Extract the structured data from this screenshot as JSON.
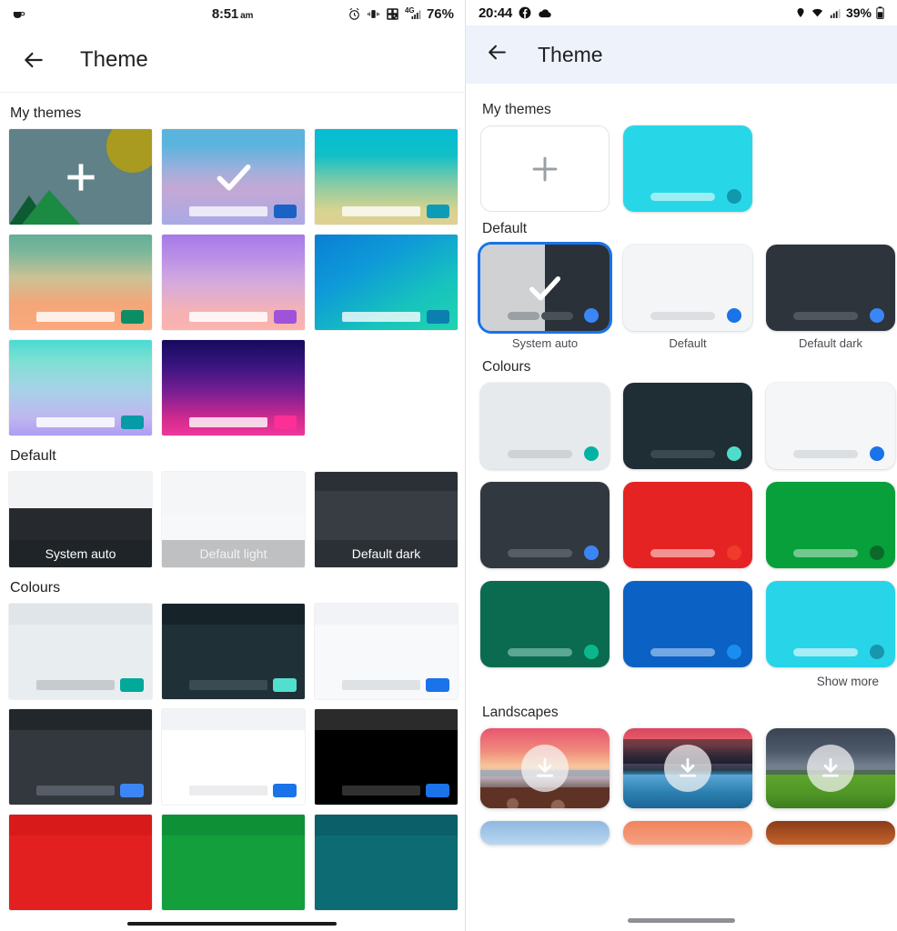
{
  "left_phone": {
    "status_bar": {
      "time": "8:51",
      "am_pm": "am",
      "battery": "76%",
      "network": "4G",
      "icons": [
        "coffee-cup-icon",
        "alarm-icon",
        "vibrate-icon",
        "qr-code-icon",
        "signal-icon"
      ]
    },
    "app_bar": {
      "back_icon": "back-arrow-icon",
      "title": "Theme"
    },
    "sections": [
      {
        "title": "My themes",
        "tiles": [
          {
            "name": "add-theme",
            "kind": "add",
            "bg": "#5f8187",
            "sun": "#a99b1f",
            "mountain": "#1b8a43",
            "mountain_dark": "#0e5b33"
          },
          {
            "name": "theme-blue-pink",
            "kind": "gradient",
            "gradient": "linear-gradient(180deg,#5bb4dd 0%,#5bb4dd 17%,#9dafdd 42%,#c5a8d4 62%,#a9a9e6 100%)",
            "bar": "rgba(255,255,255,0.72)",
            "chip": "#1a62c4",
            "selected": true
          },
          {
            "name": "theme-cyan-khaki",
            "kind": "gradient",
            "gradient": "linear-gradient(180deg,#04bcd4 0%,#12c0c6 28%,#7fcaa8 55%,#d8d38f 85%,#ded093 100%)",
            "bar": "rgba(255,255,255,0.78)",
            "chip": "#0d9cb8",
            "selected": false
          },
          {
            "name": "theme-green-orange",
            "kind": "gradient",
            "gradient": "linear-gradient(180deg,#63ad97 0%,#7bb79a 18%,#cbc295 45%,#f3a779 72%,#fba87c 100%)",
            "bar": "rgba(255,255,255,0.82)",
            "chip": "#0d8d63",
            "selected": false
          },
          {
            "name": "theme-purple-pink",
            "kind": "gradient",
            "gradient": "linear-gradient(180deg,#a779e8 0%,#b68ce8 20%,#d4aadd 50%,#f4b2b5 80%,#fbb3ad 100%)",
            "bar": "rgba(255,255,255,0.86)",
            "chip": "#a052d8",
            "selected": false
          },
          {
            "name": "theme-blue-teal",
            "kind": "gradient",
            "gradient": "linear-gradient(150deg,#0a7fd4 0%,#0e9ad8 35%,#17c3bd 70%,#20d3b0 100%)",
            "bar": "rgba(255,255,255,0.78)",
            "chip": "#0b7fae",
            "selected": false
          },
          {
            "name": "theme-aqua-lilac",
            "kind": "gradient",
            "gradient": "linear-gradient(180deg,#49dbd3 0%,#7fe0d3 22%,#a7d2e8 52%,#bfb6f0 82%,#ae9cf2 100%)",
            "bar": "rgba(255,255,255,0.85)",
            "chip": "#069ba6",
            "selected": false
          },
          {
            "name": "theme-indigo-magenta",
            "kind": "gradient",
            "gradient": "linear-gradient(180deg,#160a5e 0%,#3b1580 28%,#7a1f93 55%,#d12a8e 82%,#f0369a 100%)",
            "bar": "rgba(255,255,255,0.80)",
            "chip": "#fb2f95",
            "selected": false
          }
        ]
      },
      {
        "title": "Default",
        "tiles": [
          {
            "name": "system-auto",
            "label": "System auto",
            "top": "#f1f3f5",
            "bottom": "#262a2e",
            "label_bg": "#1f2428",
            "label_color": "#ffffff"
          },
          {
            "name": "default-light",
            "label": "Default light",
            "top": "#f5f6f8",
            "bottom": "#f7f8fa",
            "label_bg": "#bfc0c2",
            "label_color": "#f2f2f2"
          },
          {
            "name": "default-dark",
            "label": "Default dark",
            "top": "#2b3036",
            "bottom": "#383d44",
            "label_bg": "#2b3036",
            "label_color": "#ffffff"
          }
        ]
      },
      {
        "title": "Colours",
        "tiles": [
          {
            "name": "colour-light-grey",
            "bg": "#e8edef",
            "band": "#dfe5e8",
            "bar": "#c7cbcd",
            "chip": "#00a99a"
          },
          {
            "name": "colour-dark-teal",
            "bg": "#1f3036",
            "band": "#16242a",
            "bar": "#3a4c52",
            "chip": "#52dfcf"
          },
          {
            "name": "colour-white-blue",
            "bg": "#f8f9fb",
            "band": "#f1f3f6",
            "bar": "#dfe2e5",
            "chip": "#1a73e8"
          },
          {
            "name": "colour-charcoal-blue",
            "bg": "#33383f",
            "band": "#22272c",
            "bar": "#565d66",
            "chip": "#3b86f7"
          },
          {
            "name": "colour-white",
            "bg": "#ffffff",
            "band": "#f1f3f6",
            "bar": "#ececee",
            "chip": "#1a73e8"
          },
          {
            "name": "colour-black",
            "bg": "#000000",
            "band": "#2b2b2b",
            "bar": "#303030",
            "chip": "#1a73e8"
          },
          {
            "name": "colour-red",
            "bg": "#e32020",
            "band": "#d81a1a",
            "bar": "#f08a8a",
            "chip": "#d11c1c"
          },
          {
            "name": "colour-green",
            "bg": "#13a03c",
            "band": "#0e9136",
            "bar": "#7fcb96",
            "chip": "#0c7a2c"
          },
          {
            "name": "colour-teal",
            "bg": "#0d6b73",
            "band": "#0a5f68",
            "bar": "#5aa7ad",
            "chip": "#0a5359"
          }
        ]
      }
    ]
  },
  "right_phone": {
    "status_bar": {
      "time": "20:44",
      "battery": "39%",
      "icons": [
        "facebook-icon",
        "cloud-icon",
        "location-pin-icon",
        "wifi-icon",
        "signal-icon",
        "battery-icon"
      ]
    },
    "app_bar": {
      "back_icon": "back-arrow-icon",
      "title": "Theme",
      "bg": "#eef2fb"
    },
    "sections": [
      {
        "title": "My themes",
        "cards": [
          {
            "name": "add-theme",
            "kind": "add",
            "plus_color": "#9aa0a6"
          },
          {
            "name": "theme-cyan",
            "kind": "solid",
            "bg": "#27d7e8",
            "bar": "rgba(255,255,255,0.55)",
            "dot": "#1298ad"
          }
        ]
      },
      {
        "title": "Default",
        "cards": [
          {
            "name": "system-auto",
            "label": "System auto",
            "kind": "split",
            "left_bg": "#cfd1d3",
            "right_bg": "#2b3139",
            "bar_left": "#9ba0a4",
            "bar_right": "#4a5058",
            "dot": "#3b86f7",
            "selected": true
          },
          {
            "name": "default",
            "label": "Default",
            "kind": "solid",
            "bg": "#f4f5f7",
            "bar": "#dcdee1",
            "dot": "#1a73e8",
            "selected": false
          },
          {
            "name": "default-dark",
            "label": "Default dark",
            "kind": "solid",
            "bg": "#2e343b",
            "bar": "#4f565e",
            "dot": "#3b86f7",
            "selected": false
          }
        ]
      },
      {
        "title": "Colours",
        "show_more": "Show more",
        "cards": [
          {
            "name": "colour-light-grey",
            "bg": "#e7eaec",
            "bar": "#cfd2d5",
            "dot": "#00b3a4"
          },
          {
            "name": "colour-dark-teal",
            "bg": "#1f2d34",
            "bar": "#3a4950",
            "dot": "#4fdccb"
          },
          {
            "name": "colour-off-white",
            "bg": "#f4f6f8",
            "bar": "#dcdfe2",
            "dot": "#1a73e8"
          },
          {
            "name": "colour-charcoal",
            "bg": "#32383f",
            "bar": "#565d66",
            "dot": "#3b86f7"
          },
          {
            "name": "colour-red",
            "bg": "#e62323",
            "bar": "#f49292",
            "dot": "#f03a2a"
          },
          {
            "name": "colour-green",
            "bg": "#07a03a",
            "bar": "#74c78f",
            "dot": "#0b6a2a"
          },
          {
            "name": "colour-dark-green",
            "bg": "#0a6b51",
            "bar": "#5ca694",
            "dot": "#09b98c"
          },
          {
            "name": "colour-blue",
            "bg": "#0b62c4",
            "bar": "#74a8e3",
            "dot": "#1a8df0"
          },
          {
            "name": "colour-cyan",
            "bg": "#27d4e8",
            "bar": "#a6edf5",
            "dot": "#1896ad"
          }
        ]
      },
      {
        "title": "Landscapes",
        "cards": [
          {
            "name": "landscape-beach-sunset",
            "sky": "linear-gradient(180deg,#e8566f 0%,#f08a7c 28%,#f7c79a 48%,#b9a9b5 62%,#7e6a68 74%)",
            "ground": "#67372a",
            "download_icon": "download-icon"
          },
          {
            "name": "landscape-river-sunset",
            "sky": "linear-gradient(180deg,#d9455f 0%,#ea6a6e 22%,#4a3f55 42%,#2a3a48 56%)",
            "ground": "#2f7fae",
            "download_icon": "download-icon"
          },
          {
            "name": "landscape-green-hills",
            "sky": "linear-gradient(180deg,#3a4453 0%,#4c5768 30%,#6d7a88 52%)",
            "ground": "#55a028",
            "download_icon": "download-icon"
          }
        ],
        "peek_cards": [
          {
            "name": "landscape-peek-blue",
            "bg": "linear-gradient(180deg,#8fb9e0 0%,#b9d6ef 100%)"
          },
          {
            "name": "landscape-peek-orange",
            "bg": "linear-gradient(180deg,#f0845c 0%,#f5a183 100%)"
          },
          {
            "name": "landscape-peek-brown",
            "bg": "linear-gradient(180deg,#8a3c18 0%,#c4632c 100%)"
          }
        ]
      }
    ]
  }
}
